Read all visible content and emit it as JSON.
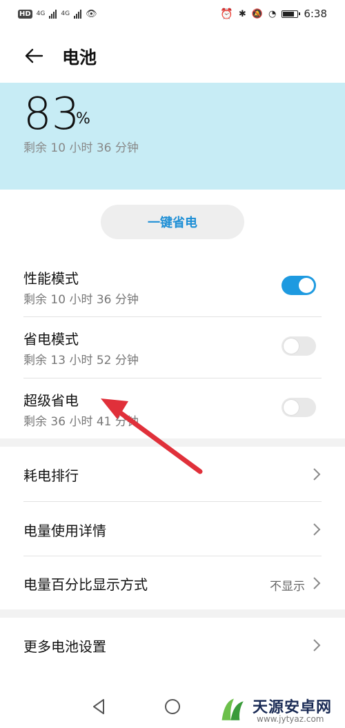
{
  "status_bar": {
    "hd_label": "HD",
    "network1": "4G",
    "network2": "4G",
    "time": "6:38",
    "battery_level": 0.83
  },
  "header": {
    "title": "电池"
  },
  "summary": {
    "percent": "83",
    "percent_sign": "%",
    "remaining": "剩余 10 小时 36 分钟",
    "background": "#c7ecf5"
  },
  "save_button": {
    "label": "一键省电",
    "color": "#1e8fd6"
  },
  "modes": [
    {
      "title": "性能模式",
      "subtitle": "剩余 10 小时 36 分钟",
      "enabled": true
    },
    {
      "title": "省电模式",
      "subtitle": "剩余 13 小时 52 分钟",
      "enabled": false
    },
    {
      "title": "超级省电",
      "subtitle": "剩余 36 小时 41 分钟",
      "enabled": false
    }
  ],
  "settings": [
    {
      "label": "耗电排行",
      "value": ""
    },
    {
      "label": "电量使用详情",
      "value": ""
    },
    {
      "label": "电量百分比显示方式",
      "value": "不显示"
    }
  ],
  "more": {
    "label": "更多电池设置"
  },
  "watermark": {
    "name": "天源安卓网",
    "url": "www.jytyaz.com"
  },
  "colors": {
    "accent": "#1e9ae0",
    "annotation_arrow": "#e0303a"
  },
  "icons": [
    "back-arrow-icon",
    "chevron-right-icon",
    "nav-back-icon",
    "nav-home-icon",
    "alarm-icon",
    "bluetooth-icon",
    "mute-icon",
    "battery-icon"
  ]
}
